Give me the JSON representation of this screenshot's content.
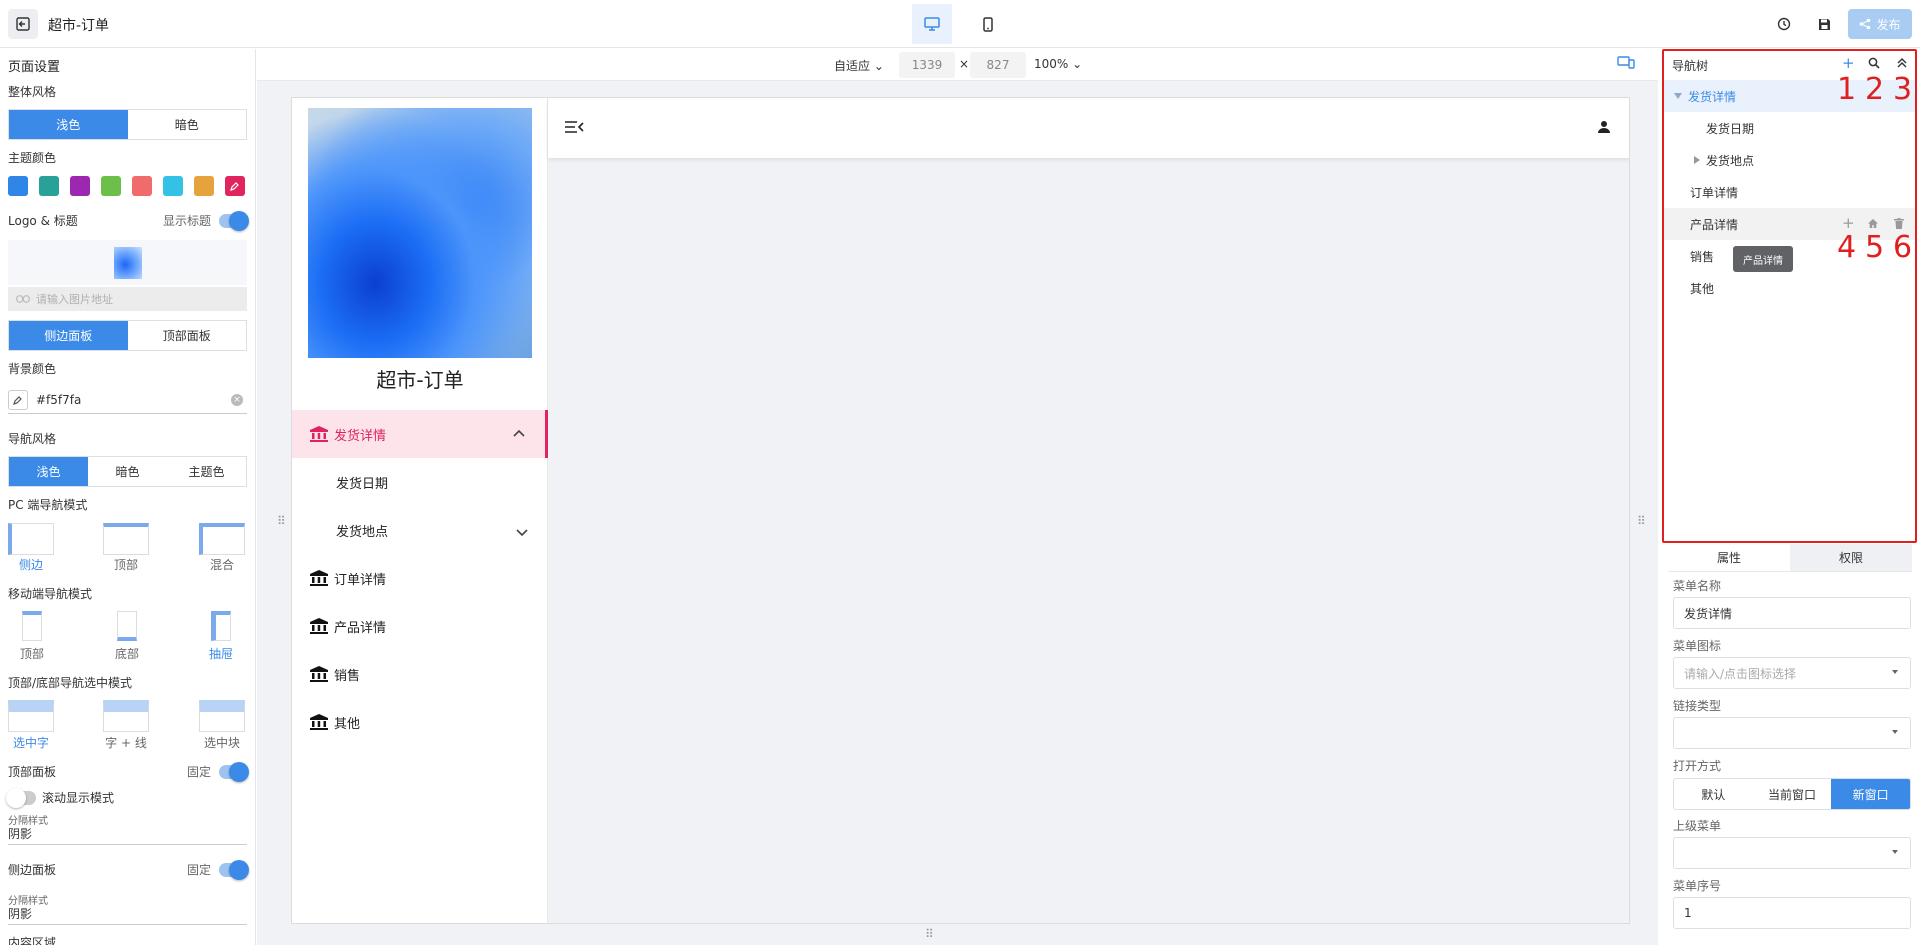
{
  "topbar": {
    "title": "超市-订单",
    "publish_label": "发布"
  },
  "left": {
    "page_settings": "页面设置",
    "overall_style": "整体风格",
    "style_options": [
      "浅色",
      "暗色"
    ],
    "theme_color_label": "主题颜色",
    "theme_colors": [
      "#2f86e6",
      "#2aa198",
      "#9c27b0",
      "#6cc04a",
      "#f06c6c",
      "#33c2e6",
      "#e6a23c",
      "#e0245e"
    ],
    "logo_title_label": "Logo & 标题",
    "show_title_label": "显示标题",
    "url_placeholder": "请输入图片地址",
    "panel_options": [
      "侧边面板",
      "顶部面板"
    ],
    "bg_color_label": "背景颜色",
    "bg_color_value": "#f5f7fa",
    "nav_style_label": "导航风格",
    "nav_style_options": [
      "浅色",
      "暗色",
      "主题色"
    ],
    "pc_nav_mode_label": "PC 端导航模式",
    "pc_nav_modes": [
      "侧边",
      "顶部",
      "混合"
    ],
    "mobile_nav_mode_label": "移动端导航模式",
    "mobile_nav_modes": [
      "顶部",
      "底部",
      "抽屉"
    ],
    "selected_mode_label": "顶部/底部导航选中模式",
    "selected_modes": [
      "选中字",
      "字 + 线",
      "选中块"
    ],
    "top_panel_label": "顶部面板",
    "fixed_label": "固定",
    "scroll_mode_label": "滚动显示模式",
    "divider_style_label": "分隔样式",
    "divider_value": "阴影",
    "side_panel_label": "侧边面板",
    "content_area_label": "内容区域"
  },
  "canvas": {
    "fit_label": "自适应",
    "width": "1339",
    "times": "×",
    "height": "827",
    "zoom": "100%"
  },
  "preview": {
    "app_title": "超市-订单",
    "menu": [
      {
        "label": "发货详情",
        "icon": "bank-icon"
      },
      {
        "label": "发货日期",
        "icon": ""
      },
      {
        "label": "发货地点",
        "icon": ""
      },
      {
        "label": "订单详情",
        "icon": "bank-icon"
      },
      {
        "label": "产品详情",
        "icon": "bank-icon"
      },
      {
        "label": "销售",
        "icon": "bank-icon"
      },
      {
        "label": "其他",
        "icon": "bank-icon"
      }
    ]
  },
  "nav_tree": {
    "title": "导航树",
    "nodes": [
      "发货详情",
      "发货日期",
      "发货地点",
      "订单详情",
      "产品详情",
      "销售",
      "其他"
    ],
    "tooltip": "产品详情",
    "annotations": [
      "1",
      "2",
      "3",
      "4",
      "5",
      "6"
    ]
  },
  "props": {
    "tabs": [
      "属性",
      "权限"
    ],
    "menu_name_label": "菜单名称",
    "menu_name_value": "发货详情",
    "menu_icon_label": "菜单图标",
    "menu_icon_placeholder": "请输入/点击图标选择",
    "link_type_label": "链接类型",
    "open_mode_label": "打开方式",
    "open_modes": [
      "默认",
      "当前窗口",
      "新窗口"
    ],
    "parent_menu_label": "上级菜单",
    "menu_order_label": "菜单序号",
    "menu_order_value": "1"
  }
}
